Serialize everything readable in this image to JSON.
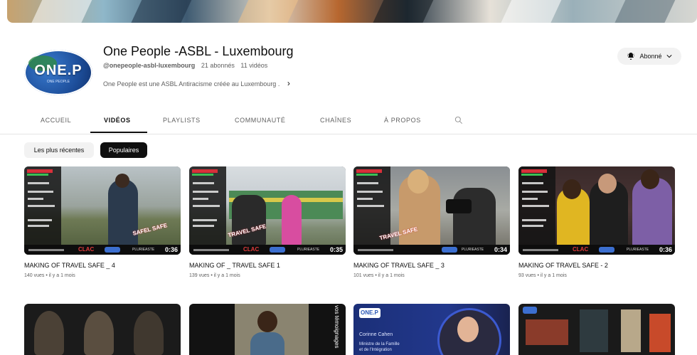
{
  "channel": {
    "name": "One People -ASBL - Luxembourg",
    "handle": "@onepeople-asbl-luxembourg",
    "subscribers": "21 abonnés",
    "videos_count": "11 vidéos",
    "description": "One People est une ASBL Antiracisme créée au Luxembourg .",
    "avatar_text": "ONE.P",
    "avatar_subtext": "ONE PEOPLE",
    "subscribe_label": "Abonné"
  },
  "tabs": [
    {
      "label": "ACCUEIL"
    },
    {
      "label": "VIDÉOS"
    },
    {
      "label": "PLAYLISTS"
    },
    {
      "label": "COMMUNAUTÉ"
    },
    {
      "label": "CHAÎNES"
    },
    {
      "label": "À PROPOS"
    }
  ],
  "chips": [
    {
      "label": "Les plus récentes"
    },
    {
      "label": "Populaires"
    }
  ],
  "videos": [
    {
      "title": "MAKING OF TRAVEL SAFE _ 4",
      "meta": "140 vues • il y a 1 mois",
      "duration": "0:36",
      "tag": "SAFEL SAFE"
    },
    {
      "title": "MAKING OF _ TRAVEL SAFE 1",
      "meta": "139 vues • il y a 1 mois",
      "duration": "0:35",
      "tag": "TRAVEL SAFE"
    },
    {
      "title": "MAKING OF TRAVEL SAFE _ 3",
      "meta": "101 vues • il y a 1 mois",
      "duration": "0:34",
      "tag": "TRAVEL SAFE"
    },
    {
      "title": "MAKING OF TRAVEL SAFE - 2",
      "meta": "93 vues • il y a 1 mois",
      "duration": "0:36",
      "tag": ""
    }
  ],
  "thumb_labels": {
    "clac": "CLAC",
    "plur": "PLURIEASTE"
  },
  "bottom_row": {
    "t2_side": "vos témoignages",
    "t3_logo": "ONE.P",
    "t3_name": "Corinne Cahen",
    "t3_line1": "Ministre de la Famille",
    "t3_line2": "et de l'Intégration"
  },
  "colors": {
    "accent": "#0f0f0f",
    "chip_bg": "#f2f2f2",
    "meta_text": "#606060",
    "clac_red": "#e23b3b"
  }
}
